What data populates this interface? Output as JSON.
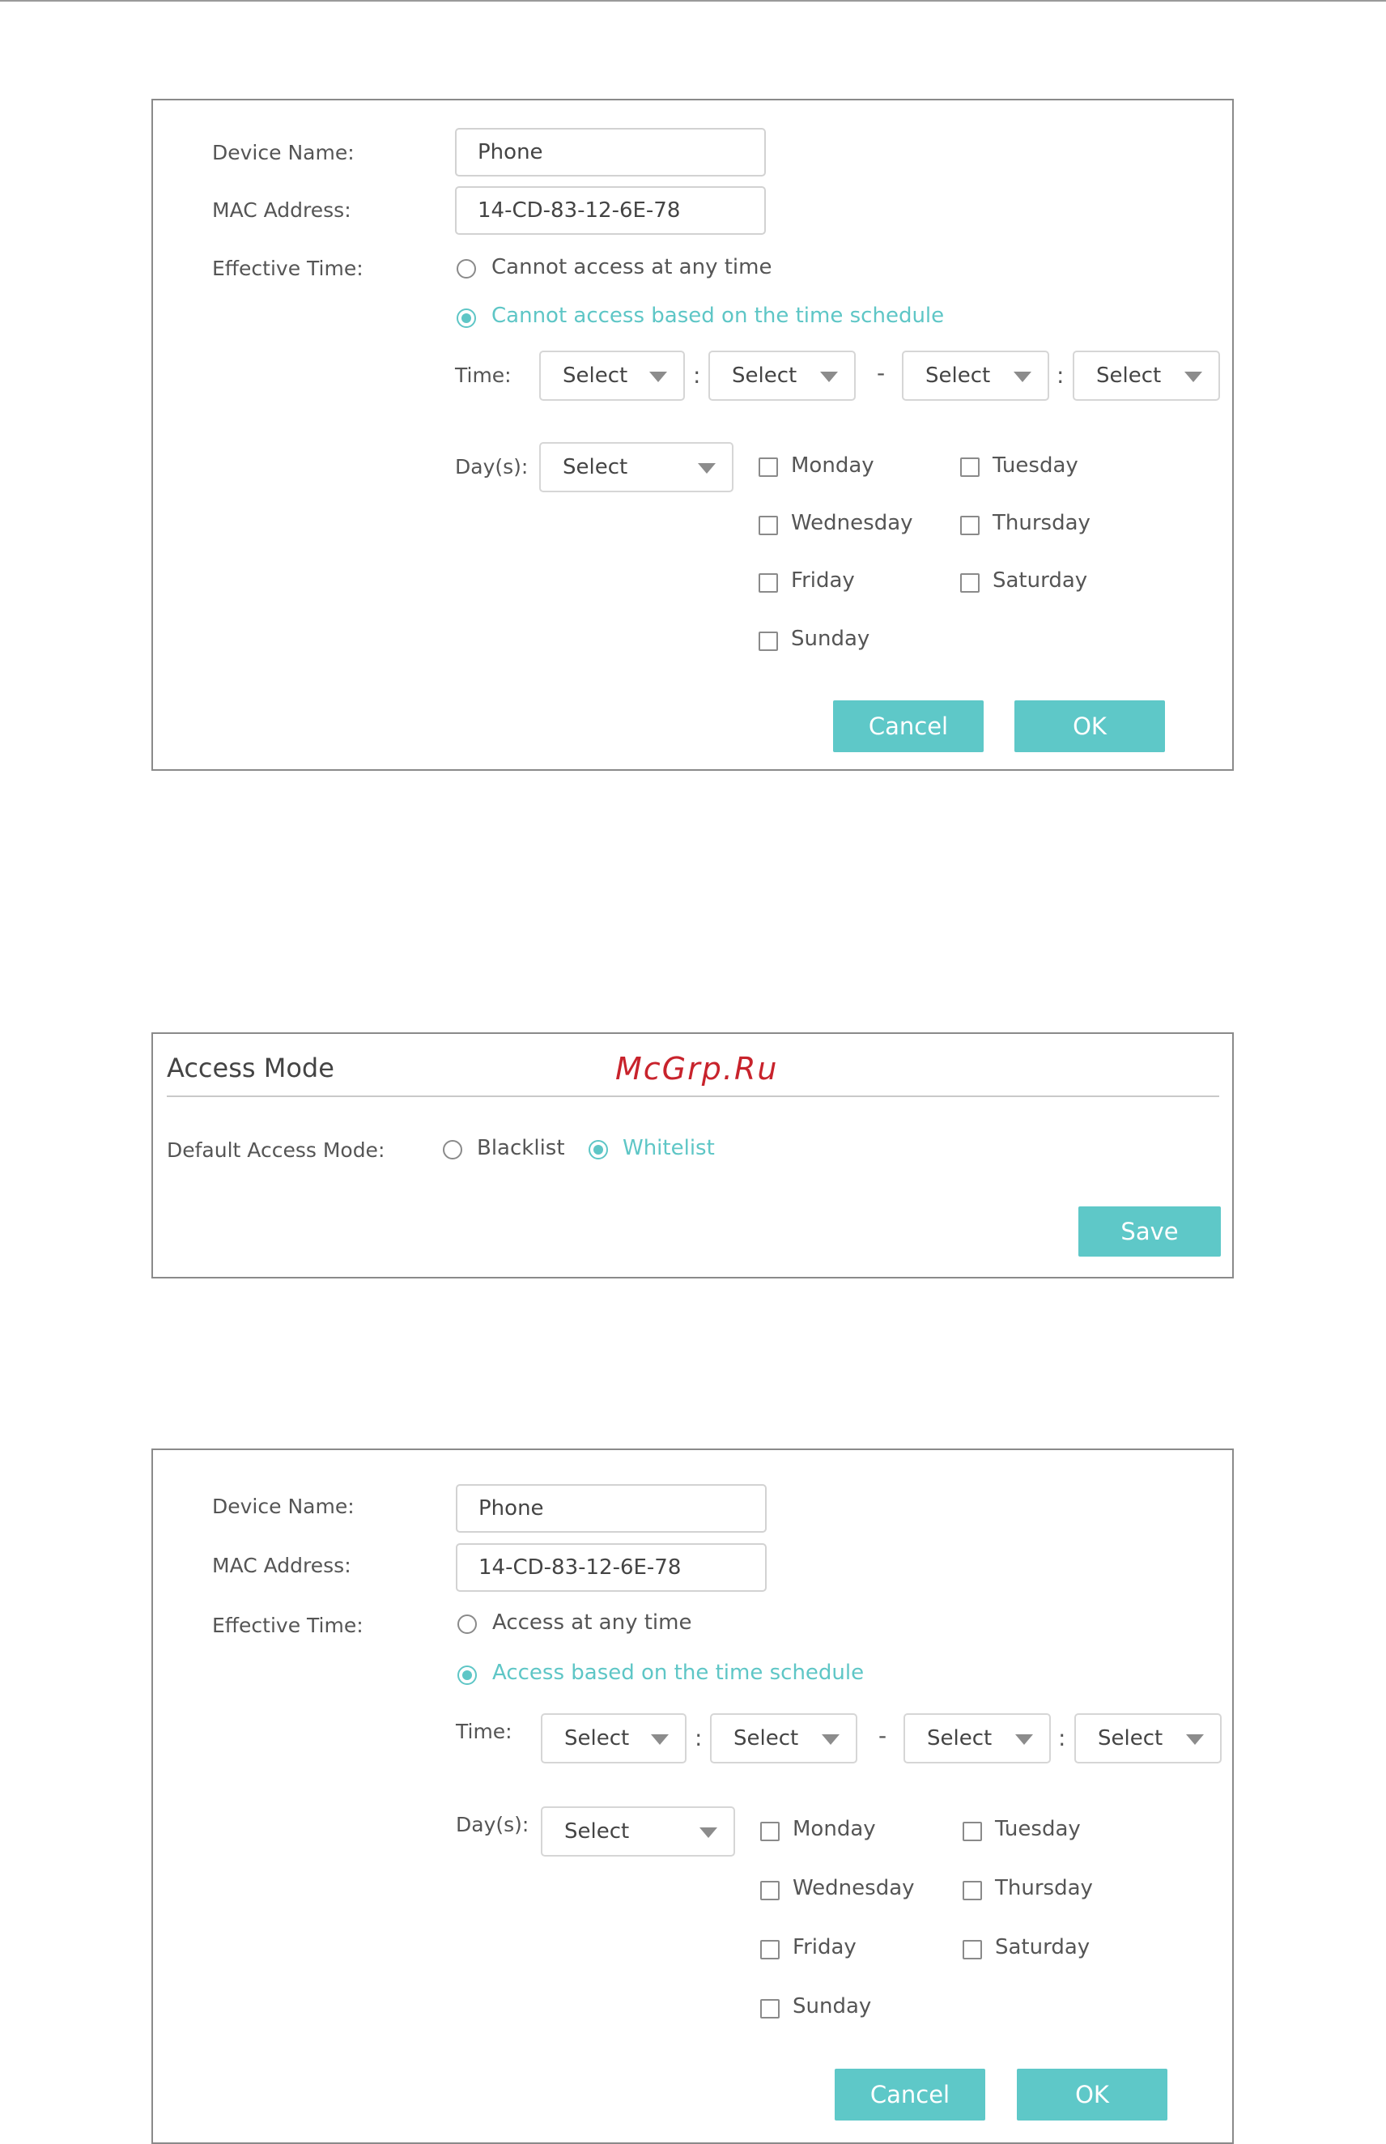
{
  "watermark": "McGrp.Ru",
  "accent_color": "#5ec8c8",
  "blacklist_form": {
    "device_name_label": "Device Name:",
    "device_name_value": "Phone",
    "mac_address_label": "MAC Address:",
    "mac_address_value": "14-CD-83-12-6E-78",
    "effective_time_label": "Effective Time:",
    "radio_any_time": "Cannot access at any time",
    "radio_schedule": "Cannot access based on the time schedule",
    "selected_radio": "schedule",
    "time_label": "Time:",
    "time_selects": [
      "Select",
      "Select",
      "Select",
      "Select"
    ],
    "time_colon": ":",
    "time_dash": "-",
    "days_label": "Day(s):",
    "days_select": "Select",
    "days": [
      "Monday",
      "Tuesday",
      "Wednesday",
      "Thursday",
      "Friday",
      "Saturday",
      "Sunday"
    ],
    "cancel_label": "Cancel",
    "ok_label": "OK"
  },
  "access_mode": {
    "title": "Access Mode",
    "default_mode_label": "Default Access Mode:",
    "blacklist_label": "Blacklist",
    "whitelist_label": "Whitelist",
    "selected": "whitelist",
    "save_label": "Save"
  },
  "whitelist_form": {
    "device_name_label": "Device Name:",
    "device_name_value": "Phone",
    "mac_address_label": "MAC Address:",
    "mac_address_value": "14-CD-83-12-6E-78",
    "effective_time_label": "Effective Time:",
    "radio_any_time": "Access at any time",
    "radio_schedule": "Access based on the time schedule",
    "selected_radio": "schedule",
    "time_label": "Time:",
    "time_selects": [
      "Select",
      "Select",
      "Select",
      "Select"
    ],
    "time_colon": ":",
    "time_dash": "-",
    "days_label": "Day(s):",
    "days_select": "Select",
    "days": [
      "Monday",
      "Tuesday",
      "Wednesday",
      "Thursday",
      "Friday",
      "Saturday",
      "Sunday"
    ],
    "cancel_label": "Cancel",
    "ok_label": "OK"
  }
}
